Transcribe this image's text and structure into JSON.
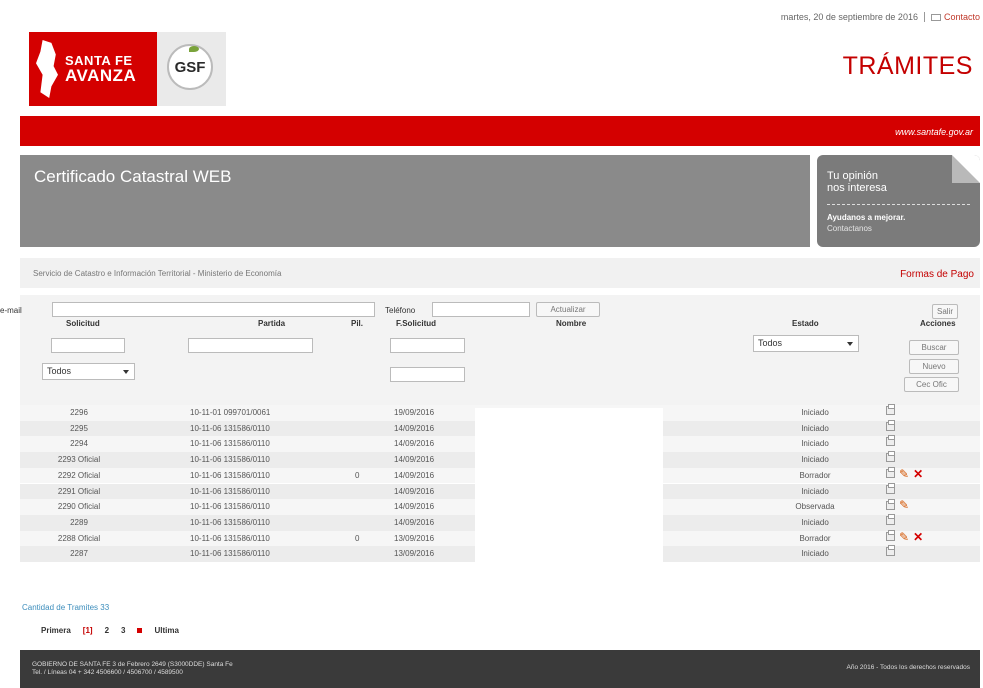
{
  "top": {
    "date": "martes, 20 de septiembre de 2016",
    "contact_label": "Contacto"
  },
  "header": {
    "logo_line1": "SANTA FE",
    "logo_line2": "AVANZA",
    "gsf_logo": "GSF",
    "section_title": "TRÁMITES",
    "site_url": "www.santafe.gov.ar"
  },
  "banner": {
    "title": "Certificado Catastral WEB",
    "opinion_line1": "Tu opinión",
    "opinion_line2": "nos interesa",
    "opinion_cta": "Ayudanos a mejorar.",
    "opinion_link": "Contactanos"
  },
  "service": {
    "text": "Servicio de Catastro e Información Territorial - Ministerio de Economía",
    "payment_link": "Formas de Pago"
  },
  "filters": {
    "email_label": "e-mail",
    "email_value": "",
    "phone_label": "Teléfono",
    "phone_value": "",
    "update_button": "Actualizar",
    "exit_button": "Salir",
    "type_select": "Todos",
    "status_select": "Todos",
    "search_button": "Buscar",
    "new_button": "Nuevo",
    "official_button": "Cec Ofic"
  },
  "columns": {
    "solicitud": "Solicitud",
    "partida": "Partida",
    "pil": "Pil.",
    "fecha": "F.Solicitud",
    "nombre": "Nombre",
    "estado": "Estado",
    "acciones": "Acciones"
  },
  "rows": [
    {
      "solicitud": "2296",
      "partida": "10-11-01 099701/0061",
      "pil": "",
      "fecha": "19/09/2016",
      "estado": "Iniciado",
      "edit": false,
      "delete": false
    },
    {
      "solicitud": "2295",
      "partida": "10-11-06 131586/0110",
      "pil": "",
      "fecha": "14/09/2016",
      "estado": "Iniciado",
      "edit": false,
      "delete": false
    },
    {
      "solicitud": "2294",
      "partida": "10-11-06 131586/0110",
      "pil": "",
      "fecha": "14/09/2016",
      "estado": "Iniciado",
      "edit": false,
      "delete": false
    },
    {
      "solicitud": "2293 Oficial",
      "partida": "10-11-06 131586/0110",
      "pil": "",
      "fecha": "14/09/2016",
      "estado": "Iniciado",
      "edit": false,
      "delete": false
    },
    {
      "solicitud": "2292 Oficial",
      "partida": "10-11-06 131586/0110",
      "pil": "0",
      "fecha": "14/09/2016",
      "estado": "Borrador",
      "edit": true,
      "delete": true
    },
    {
      "solicitud": "2291 Oficial",
      "partida": "10-11-06 131586/0110",
      "pil": "",
      "fecha": "14/09/2016",
      "estado": "Iniciado",
      "edit": false,
      "delete": false
    },
    {
      "solicitud": "2290 Oficial",
      "partida": "10-11-06 131586/0110",
      "pil": "",
      "fecha": "14/09/2016",
      "estado": "Observada",
      "edit": true,
      "delete": false
    },
    {
      "solicitud": "2289",
      "partida": "10-11-06 131586/0110",
      "pil": "",
      "fecha": "14/09/2016",
      "estado": "Iniciado",
      "edit": false,
      "delete": false
    },
    {
      "solicitud": "2288 Oficial",
      "partida": "10-11-06 131586/0110",
      "pil": "0",
      "fecha": "13/09/2016",
      "estado": "Borrador",
      "edit": true,
      "delete": true
    },
    {
      "solicitud": "2287",
      "partida": "10-11-06 131586/0110",
      "pil": "",
      "fecha": "13/09/2016",
      "estado": "Iniciado",
      "edit": false,
      "delete": false
    }
  ],
  "count_text": "Cantidad de Tramites 33",
  "pager": {
    "first": "Primera",
    "current": "[1]",
    "p2": "2",
    "p3": "3",
    "last": "Ultima"
  },
  "footer": {
    "address_line1": "GOBIERNO DE SANTA FE 3 de Febrero 2649 (S3000DDE) Santa Fe",
    "address_line2": "Tel. / Líneas 04 + 342 4506600 / 4506700 / 4589500",
    "rights": "Año 2016 - Todos los derechos reservados"
  },
  "colors": {
    "brand_red": "#d40000",
    "banner_gray": "#8a8a8a",
    "footer_dark": "#3a3a3a"
  }
}
